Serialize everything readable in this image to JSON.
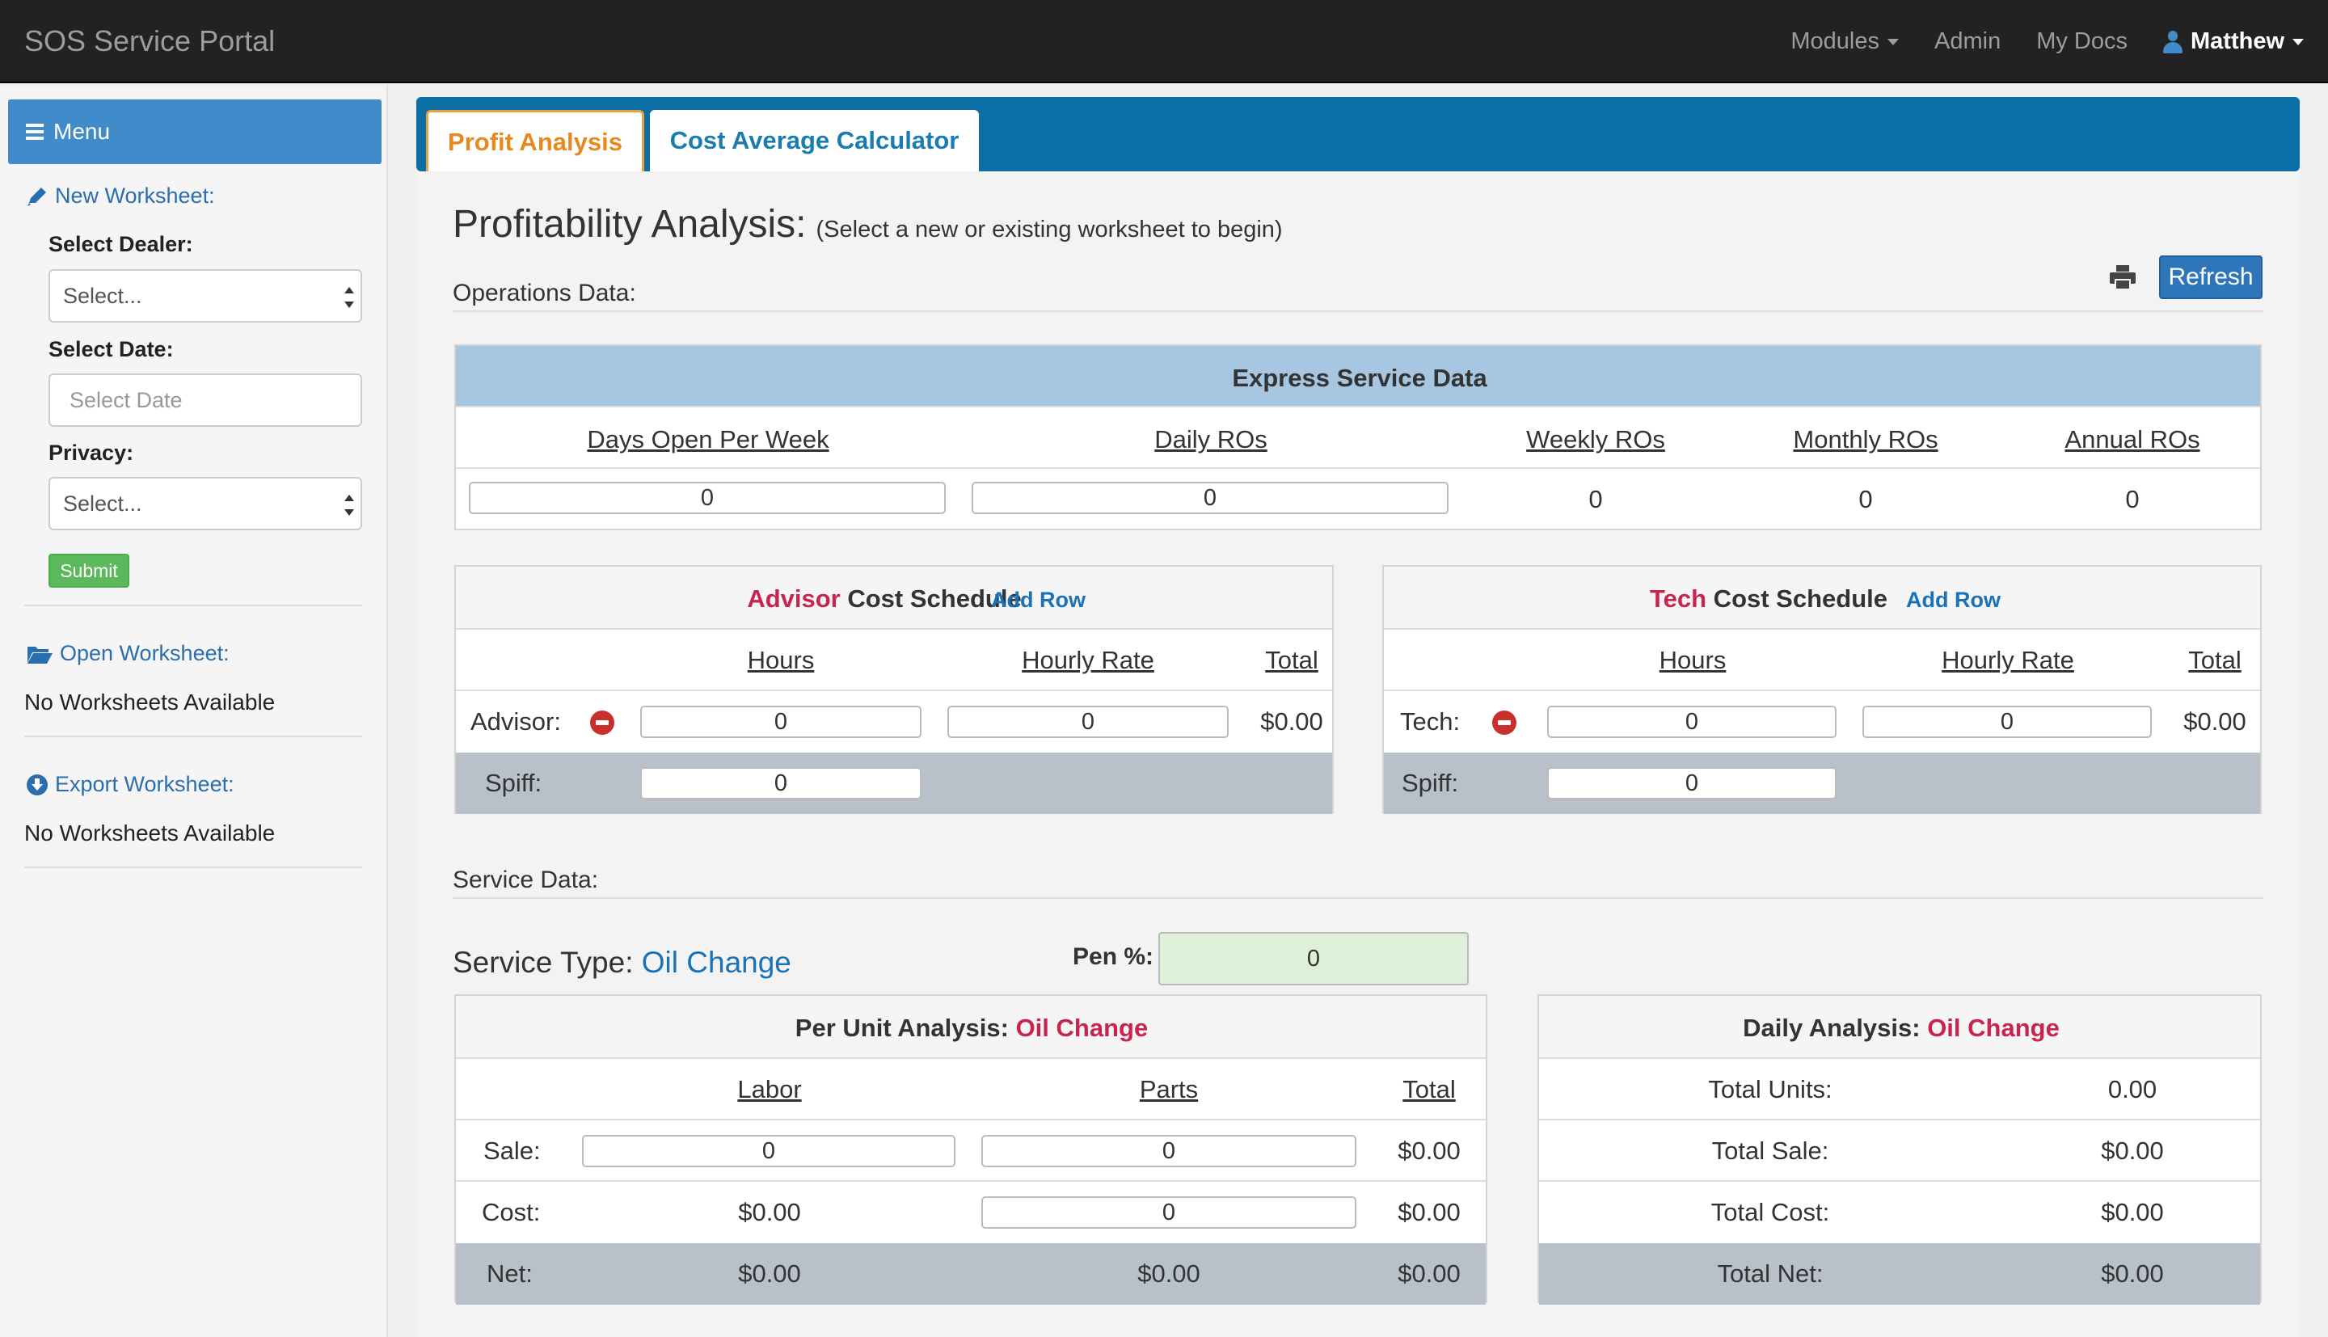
{
  "nav": {
    "brand": "SOS Service Portal",
    "modules": "Modules",
    "admin": "Admin",
    "my_docs": "My Docs",
    "user": "Matthew"
  },
  "sidebar": {
    "menu": "Menu",
    "new_worksheet": "New Worksheet:",
    "select_dealer_label": "Select Dealer:",
    "select_dealer_value": "Select...",
    "select_date_label": "Select Date:",
    "select_date_placeholder": "Select Date",
    "privacy_label": "Privacy:",
    "privacy_value": "Select...",
    "submit": "Submit",
    "open_worksheet": "Open Worksheet:",
    "open_empty": "No Worksheets Available",
    "export_worksheet": "Export Worksheet:",
    "export_empty": "No Worksheets Available"
  },
  "tabs": [
    {
      "label": "Profit Analysis",
      "active": true
    },
    {
      "label": "Cost Average Calculator",
      "active": false
    }
  ],
  "main": {
    "title": "Profitability Analysis:",
    "subtitle": "(Select a new or existing worksheet to begin)",
    "refresh": "Refresh",
    "operations_label": "Operations Data:",
    "service_label": "Service Data:"
  },
  "express": {
    "title": "Express Service Data",
    "headers": [
      "Days Open Per Week",
      "Daily ROs",
      "Weekly ROs",
      "Monthly ROs",
      "Annual ROs"
    ],
    "values": [
      "0",
      "0",
      "0",
      "0",
      "0"
    ]
  },
  "advisor": {
    "title_accent": "Advisor",
    "title_rest": "Cost Schedule",
    "add_row": "Add Row",
    "headers": [
      "Hours",
      "Hourly Rate",
      "Total"
    ],
    "row_label": "Advisor:",
    "hours": "0",
    "rate": "0",
    "total": "$0.00",
    "spiff_label": "Spiff:",
    "spiff": "0"
  },
  "tech": {
    "title_accent": "Tech",
    "title_rest": "Cost Schedule",
    "add_row": "Add Row",
    "headers": [
      "Hours",
      "Hourly Rate",
      "Total"
    ],
    "row_label": "Tech:",
    "hours": "0",
    "rate": "0",
    "total": "$0.00",
    "spiff_label": "Spiff:",
    "spiff": "0"
  },
  "service": {
    "type_label": "Service Type:",
    "type_value": "Oil Change",
    "pen_label": "Pen %:",
    "pen_value": "0"
  },
  "per_unit": {
    "title": "Per Unit Analysis:",
    "title_accent": "Oil Change",
    "headers": [
      "Labor",
      "Parts",
      "Total"
    ],
    "sale_label": "Sale:",
    "sale_labor": "0",
    "sale_parts": "0",
    "sale_total": "$0.00",
    "cost_label": "Cost:",
    "cost_labor": "$0.00",
    "cost_parts": "0",
    "cost_total": "$0.00",
    "net_label": "Net:",
    "net_labor": "$0.00",
    "net_parts": "$0.00",
    "net_total": "$0.00"
  },
  "daily": {
    "title": "Daily Analysis:",
    "title_accent": "Oil Change",
    "rows": [
      {
        "label": "Total Units:",
        "value": "0.00"
      },
      {
        "label": "Total Sale:",
        "value": "$0.00"
      },
      {
        "label": "Total Cost:",
        "value": "$0.00"
      },
      {
        "label": "Total Net:",
        "value": "$0.00"
      }
    ]
  }
}
